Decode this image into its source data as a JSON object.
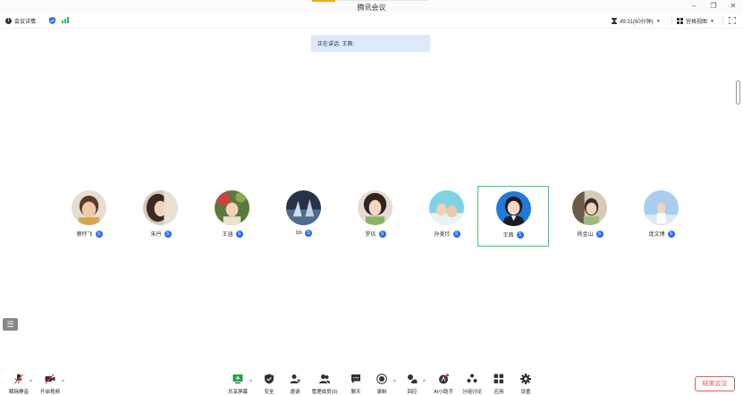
{
  "window": {
    "title": "腾讯会议",
    "controls": [
      "minimize",
      "restore",
      "close"
    ]
  },
  "topbar": {
    "meeting_info_label": "会议详情",
    "timer": "49:31(60分钟)",
    "view_label": "宫格视图"
  },
  "banner": {
    "speaking_text": "正在讲话: 王茜;"
  },
  "participants": [
    {
      "name": "蔡怀飞",
      "badge": "S",
      "active": false
    },
    {
      "name": "朱丹",
      "badge": "S",
      "active": false
    },
    {
      "name": "王涵",
      "badge": "S",
      "active": false
    },
    {
      "name": "bb",
      "badge": "S",
      "active": false
    },
    {
      "name": "罗玖",
      "badge": "S",
      "active": false
    },
    {
      "name": "孙美玲",
      "badge": "S",
      "active": false
    },
    {
      "name": "王茜",
      "badge": "S",
      "active": true
    },
    {
      "name": "杨金山",
      "badge": "S",
      "active": false
    },
    {
      "name": "庞文博",
      "badge": "S",
      "active": false
    }
  ],
  "toolbar": {
    "unmute_label": "解除静音",
    "video_label": "开启视频",
    "share_label": "共享屏幕",
    "security_label": "安全",
    "invite_label": "邀请",
    "members_label": "管理成员(9)",
    "chat_label": "聊天",
    "record_label": "录制",
    "reactions_label": "回应",
    "ai_label": "AI小助手",
    "breakout_label": "分组讨论",
    "apps_label": "应用",
    "settings_label": "设置",
    "end_label": "结束会议"
  },
  "colors": {
    "accent_blue": "#2e6bf0",
    "active_border": "#3ecf7a",
    "end_red": "#e85a5a",
    "banner_bg": "#dde9fb",
    "signal_green": "#27c24c"
  }
}
